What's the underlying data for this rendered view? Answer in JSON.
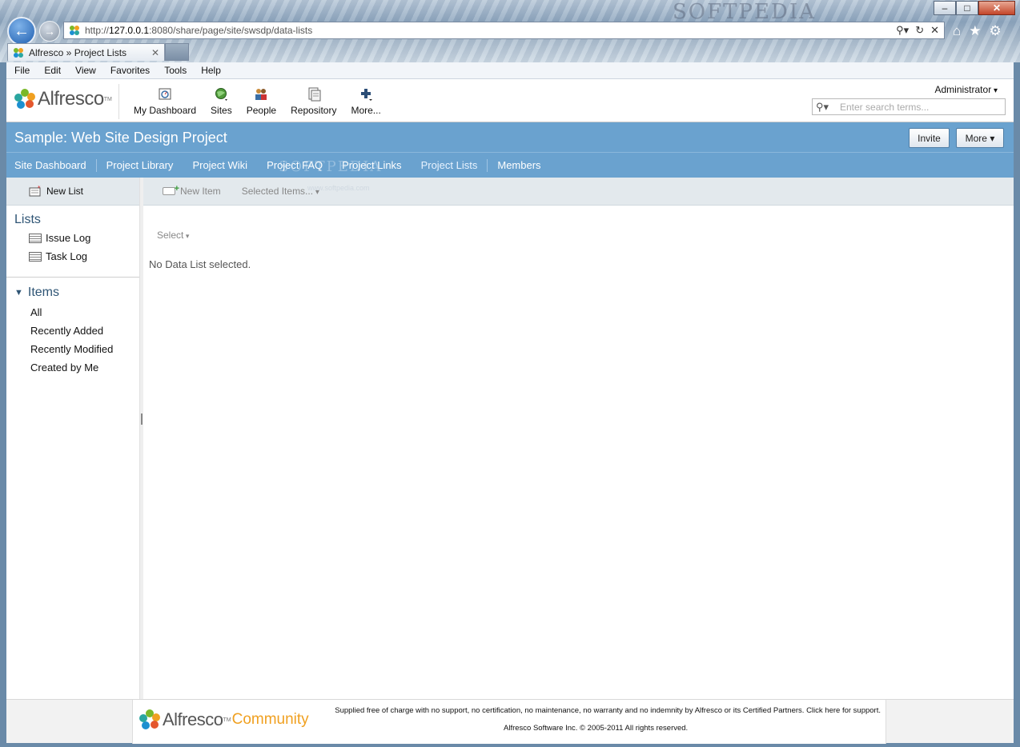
{
  "browser": {
    "url_prefix": "http://",
    "url_host": "127.0.0.1",
    "url_rest": ":8080/share/page/site/swsdp/data-lists",
    "tab_title": "Alfresco » Project Lists",
    "watermark": "SOFTPEDIA"
  },
  "menubar": [
    "File",
    "Edit",
    "View",
    "Favorites",
    "Tools",
    "Help"
  ],
  "header": {
    "logo_text": "Alfresco",
    "apps": [
      {
        "label": "My Dashboard",
        "icon": "dashboard-icon"
      },
      {
        "label": "Sites",
        "icon": "globe-icon"
      },
      {
        "label": "People",
        "icon": "people-icon"
      },
      {
        "label": "Repository",
        "icon": "repository-icon"
      },
      {
        "label": "More...",
        "icon": "plus-icon"
      }
    ],
    "user": "Administrator",
    "search_placeholder": "Enter search terms..."
  },
  "site": {
    "title": "Sample: Web Site Design Project",
    "invite_label": "Invite",
    "more_label": "More",
    "nav": [
      "Site Dashboard",
      "Project Library",
      "Project Wiki",
      "Project FAQ",
      "Project Links",
      "Project Lists",
      "Members"
    ],
    "active_nav": "Project Lists"
  },
  "sidebar": {
    "new_list_label": "New List",
    "lists_heading": "Lists",
    "lists": [
      "Issue Log",
      "Task Log"
    ],
    "items_heading": "Items",
    "filters": [
      "All",
      "Recently Added",
      "Recently Modified",
      "Created by Me"
    ]
  },
  "main": {
    "new_item_label": "New Item",
    "selected_items_label": "Selected Items...",
    "select_label": "Select",
    "empty_message": "No Data List selected."
  },
  "footer": {
    "logo_word1": "Alfresco",
    "logo_word2": "Community",
    "notice": "Supplied free of charge with no support, no certification, no maintenance, no warranty and no indemnity by Alfresco or its Certified Partners. Click here for support.",
    "copyright": "Alfresco Software Inc. © 2005-2011 All rights reserved.",
    "watermark_small": "www.softpedia.com"
  },
  "colors": {
    "site_bar": "#6aa2cf",
    "toolbar": "#e3e9ed",
    "community_orange": "#f0a020"
  }
}
